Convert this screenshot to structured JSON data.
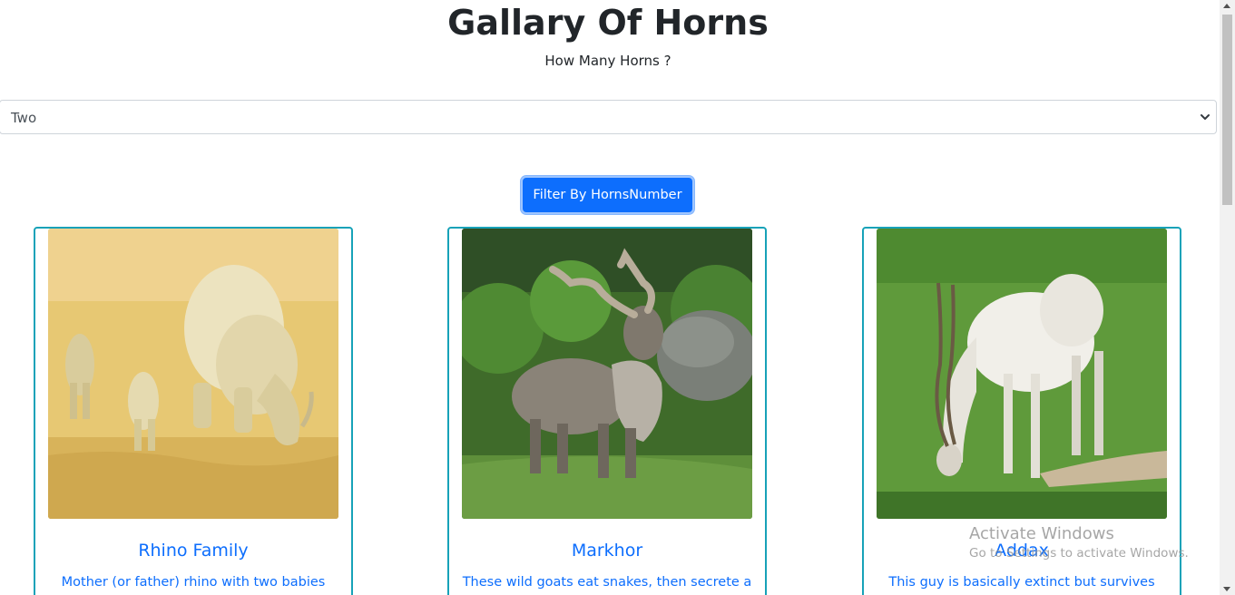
{
  "header": {
    "title": "Gallary Of Horns",
    "subtitle": "How Many Horns ?"
  },
  "filter": {
    "selected": "Two",
    "button_label": "Filter By HornsNumber"
  },
  "cards": [
    {
      "name": "Rhino Family",
      "description": "Mother (or father) rhino with two babies"
    },
    {
      "name": "Markhor",
      "description": "These wild goats eat snakes, then secrete a"
    },
    {
      "name": "Addax",
      "description": "This guy is basically extinct but survives"
    }
  ],
  "watermark": {
    "title": "Activate Windows",
    "subtitle": "Go to Settings to activate Windows."
  },
  "colors": {
    "primary": "#0d6efd",
    "card_border": "#17a2b8"
  }
}
